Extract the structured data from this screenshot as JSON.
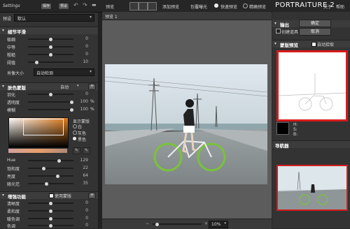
{
  "topbar": {
    "settings_label": "Settings",
    "save_label": "保存",
    "preset_label": "预设",
    "preview_label": "预览",
    "add_preview_label": "添加预览",
    "include_exposure_label": "包覆曝光",
    "fast_preview_label": "快速预览",
    "fine_preview_label": "精确预览"
  },
  "left": {
    "preset_label": "预设",
    "preset_value": "默认",
    "detail": {
      "title": "细节平滑",
      "rows": [
        {
          "label": "极细",
          "value": "0"
        },
        {
          "label": "中等",
          "value": "0"
        },
        {
          "label": "粗糙",
          "value": "0"
        },
        {
          "label": "阈值",
          "value": "10"
        }
      ],
      "portrait_size_label": "肖像大小",
      "portrait_size_value": "自动检测"
    },
    "skin": {
      "title": "肤色蒙版",
      "mode_value": "自动",
      "rows": [
        {
          "label": "羽化",
          "value": "0"
        },
        {
          "label": "透明度",
          "value": "100",
          "unit": "%"
        },
        {
          "label": "模糊",
          "value": "100",
          "unit": "%"
        }
      ],
      "show_mask_label": "显示蒙版",
      "options": [
        "白",
        "灰色",
        "黑色"
      ],
      "hue_rows": [
        {
          "label": "Hue",
          "value": "129"
        },
        {
          "label": "饱和度",
          "value": "22"
        },
        {
          "label": "亮度",
          "value": "64"
        },
        {
          "label": "随光范",
          "value": "35"
        }
      ]
    },
    "enhance": {
      "title": "增强功能",
      "use_mask_label": "使用蒙版",
      "rows": [
        {
          "label": "清晰度",
          "value": "0"
        },
        {
          "label": "柔和度",
          "value": "0"
        },
        {
          "label": "暖色调",
          "value": "0"
        },
        {
          "label": "色调",
          "value": "0"
        }
      ]
    }
  },
  "center": {
    "tab_label": "预览 1",
    "zoom_value": "10%"
  },
  "right": {
    "logo": "PORTRAITURE 2",
    "about_label": "关于",
    "help_label": "帮助",
    "output_title": "输出",
    "ok_label": "确定",
    "new_layer_label": "创建道具",
    "cancel_label": "取消",
    "mask_preview_title": "蒙版预览",
    "auto_pick_label": "自动拾取",
    "h_label": "H:",
    "s_label": "S:",
    "b_label": "B:",
    "navigator_title": "导航器"
  }
}
